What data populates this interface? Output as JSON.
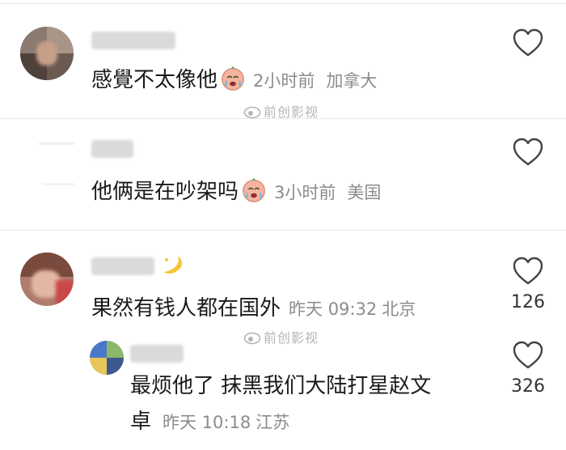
{
  "comments": [
    {
      "text": "感覺不太像他",
      "time": "2小时前",
      "location": "加拿大"
    },
    {
      "text": "他俩是在吵架吗",
      "time": "3小时前",
      "location": "美国"
    },
    {
      "text": "果然有钱人都在国外",
      "time": "昨天 09:32",
      "location": "北京",
      "likes": "126"
    },
    {
      "text_line1": "最烦他了 抹黑我们大陆打星赵文",
      "text_line2": "卓",
      "time": "昨天 10:18",
      "location": "江苏",
      "likes": "326"
    }
  ],
  "watermark": "前创影视"
}
